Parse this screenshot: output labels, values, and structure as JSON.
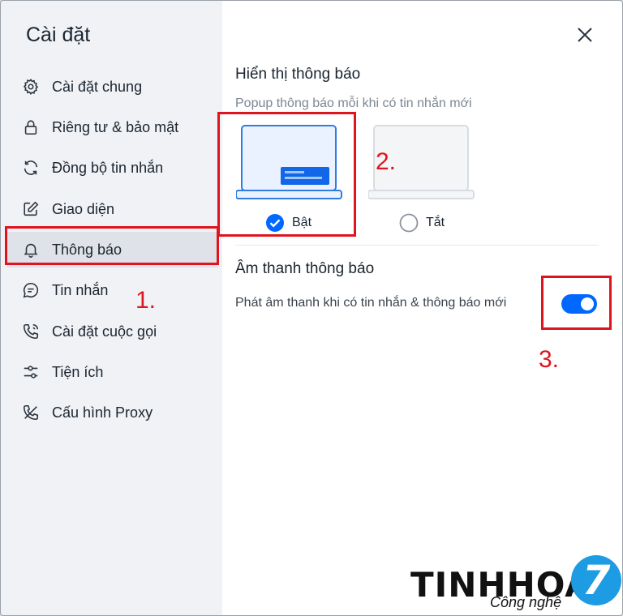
{
  "sidebar": {
    "title": "Cài đặt",
    "items": [
      {
        "label": "Cài đặt chung",
        "icon": "gear-icon"
      },
      {
        "label": "Riêng tư & bảo mật",
        "icon": "lock-icon"
      },
      {
        "label": "Đồng bộ tin nhắn",
        "icon": "sync-icon"
      },
      {
        "label": "Giao diện",
        "icon": "edit-icon"
      },
      {
        "label": "Thông báo",
        "icon": "bell-icon",
        "active": true
      },
      {
        "label": "Tin nhắn",
        "icon": "chat-icon"
      },
      {
        "label": "Cài đặt cuộc gọi",
        "icon": "phone-icon"
      },
      {
        "label": "Tiện ích",
        "icon": "sliders-icon"
      },
      {
        "label": "Cấu hình Proxy",
        "icon": "proxy-icon"
      }
    ]
  },
  "notifications": {
    "title": "Hiển thị thông báo",
    "subtitle": "Popup thông báo mỗi khi có tin nhắn mới",
    "options": [
      {
        "label": "Bật",
        "selected": true
      },
      {
        "label": "Tắt",
        "selected": false
      }
    ]
  },
  "sound": {
    "title": "Âm thanh thông báo",
    "label": "Phát âm thanh khi có tin nhắn & thông báo mới",
    "enabled": true
  },
  "annotations": {
    "step1": "1.",
    "step2": "2.",
    "step3": "3."
  },
  "watermark": {
    "word": "TINHHOA",
    "digit": "7",
    "tagline": "Công nghệ"
  },
  "colors": {
    "accent": "#0068ff",
    "annotation": "#e0141e",
    "sidebar_bg": "#f0f2f5"
  }
}
